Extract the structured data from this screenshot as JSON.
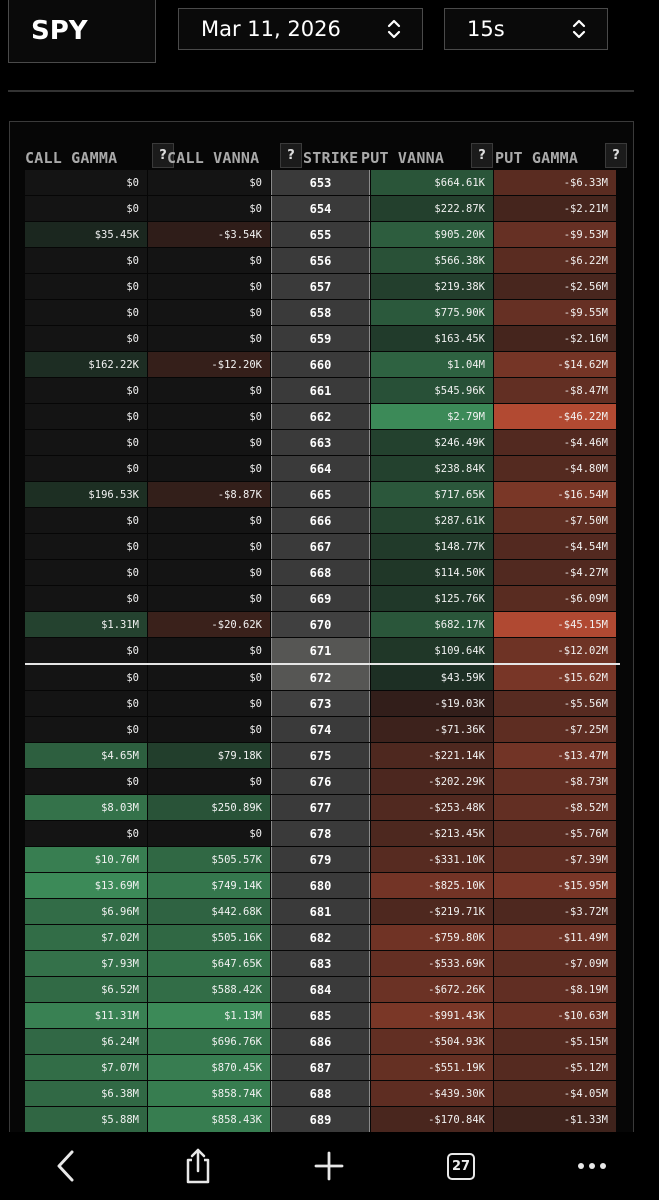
{
  "header": {
    "ticker": "SPY",
    "date": "Mar 11, 2026",
    "interval": "15s"
  },
  "table": {
    "columns": [
      {
        "label": "CALL GAMMA",
        "help": "?"
      },
      {
        "label": "CALL VANNA",
        "help": "?"
      },
      {
        "label": "STRIKE",
        "help": ""
      },
      {
        "label": "PUT VANNA",
        "help": "?"
      },
      {
        "label": "PUT GAMMA",
        "help": "?"
      }
    ],
    "current_price_after_strike": "671",
    "rows": [
      {
        "call_gamma": "$0",
        "call_vanna": "$0",
        "strike": "653",
        "put_vanna": "$664.61K",
        "put_gamma": "-$6.33M"
      },
      {
        "call_gamma": "$0",
        "call_vanna": "$0",
        "strike": "654",
        "put_vanna": "$222.87K",
        "put_gamma": "-$2.21M"
      },
      {
        "call_gamma": "$35.45K",
        "call_vanna": "-$3.54K",
        "strike": "655",
        "put_vanna": "$905.20K",
        "put_gamma": "-$9.53M"
      },
      {
        "call_gamma": "$0",
        "call_vanna": "$0",
        "strike": "656",
        "put_vanna": "$566.38K",
        "put_gamma": "-$6.22M"
      },
      {
        "call_gamma": "$0",
        "call_vanna": "$0",
        "strike": "657",
        "put_vanna": "$219.38K",
        "put_gamma": "-$2.56M"
      },
      {
        "call_gamma": "$0",
        "call_vanna": "$0",
        "strike": "658",
        "put_vanna": "$775.90K",
        "put_gamma": "-$9.55M"
      },
      {
        "call_gamma": "$0",
        "call_vanna": "$0",
        "strike": "659",
        "put_vanna": "$163.45K",
        "put_gamma": "-$2.16M"
      },
      {
        "call_gamma": "$162.22K",
        "call_vanna": "-$12.20K",
        "strike": "660",
        "put_vanna": "$1.04M",
        "put_gamma": "-$14.62M"
      },
      {
        "call_gamma": "$0",
        "call_vanna": "$0",
        "strike": "661",
        "put_vanna": "$545.96K",
        "put_gamma": "-$8.47M"
      },
      {
        "call_gamma": "$0",
        "call_vanna": "$0",
        "strike": "662",
        "put_vanna": "$2.79M",
        "put_gamma": "-$46.22M"
      },
      {
        "call_gamma": "$0",
        "call_vanna": "$0",
        "strike": "663",
        "put_vanna": "$246.49K",
        "put_gamma": "-$4.46M"
      },
      {
        "call_gamma": "$0",
        "call_vanna": "$0",
        "strike": "664",
        "put_vanna": "$238.84K",
        "put_gamma": "-$4.80M"
      },
      {
        "call_gamma": "$196.53K",
        "call_vanna": "-$8.87K",
        "strike": "665",
        "put_vanna": "$717.65K",
        "put_gamma": "-$16.54M"
      },
      {
        "call_gamma": "$0",
        "call_vanna": "$0",
        "strike": "666",
        "put_vanna": "$287.61K",
        "put_gamma": "-$7.50M"
      },
      {
        "call_gamma": "$0",
        "call_vanna": "$0",
        "strike": "667",
        "put_vanna": "$148.77K",
        "put_gamma": "-$4.54M"
      },
      {
        "call_gamma": "$0",
        "call_vanna": "$0",
        "strike": "668",
        "put_vanna": "$114.50K",
        "put_gamma": "-$4.27M"
      },
      {
        "call_gamma": "$0",
        "call_vanna": "$0",
        "strike": "669",
        "put_vanna": "$125.76K",
        "put_gamma": "-$6.09M"
      },
      {
        "call_gamma": "$1.31M",
        "call_vanna": "-$20.62K",
        "strike": "670",
        "put_vanna": "$682.17K",
        "put_gamma": "-$45.15M"
      },
      {
        "call_gamma": "$0",
        "call_vanna": "$0",
        "strike": "671",
        "put_vanna": "$109.64K",
        "put_gamma": "-$12.02M"
      },
      {
        "call_gamma": "$0",
        "call_vanna": "$0",
        "strike": "672",
        "put_vanna": "$43.59K",
        "put_gamma": "-$15.62M"
      },
      {
        "call_gamma": "$0",
        "call_vanna": "$0",
        "strike": "673",
        "put_vanna": "-$19.03K",
        "put_gamma": "-$5.56M"
      },
      {
        "call_gamma": "$0",
        "call_vanna": "$0",
        "strike": "674",
        "put_vanna": "-$71.36K",
        "put_gamma": "-$7.25M"
      },
      {
        "call_gamma": "$4.65M",
        "call_vanna": "$79.18K",
        "strike": "675",
        "put_vanna": "-$221.14K",
        "put_gamma": "-$13.47M"
      },
      {
        "call_gamma": "$0",
        "call_vanna": "$0",
        "strike": "676",
        "put_vanna": "-$202.29K",
        "put_gamma": "-$8.73M"
      },
      {
        "call_gamma": "$8.03M",
        "call_vanna": "$250.89K",
        "strike": "677",
        "put_vanna": "-$253.48K",
        "put_gamma": "-$8.52M"
      },
      {
        "call_gamma": "$0",
        "call_vanna": "$0",
        "strike": "678",
        "put_vanna": "-$213.45K",
        "put_gamma": "-$5.76M"
      },
      {
        "call_gamma": "$10.76M",
        "call_vanna": "$505.57K",
        "strike": "679",
        "put_vanna": "-$331.10K",
        "put_gamma": "-$7.39M"
      },
      {
        "call_gamma": "$13.69M",
        "call_vanna": "$749.14K",
        "strike": "680",
        "put_vanna": "-$825.10K",
        "put_gamma": "-$15.95M"
      },
      {
        "call_gamma": "$6.96M",
        "call_vanna": "$442.68K",
        "strike": "681",
        "put_vanna": "-$219.71K",
        "put_gamma": "-$3.72M"
      },
      {
        "call_gamma": "$7.02M",
        "call_vanna": "$505.16K",
        "strike": "682",
        "put_vanna": "-$759.80K",
        "put_gamma": "-$11.49M"
      },
      {
        "call_gamma": "$7.93M",
        "call_vanna": "$647.65K",
        "strike": "683",
        "put_vanna": "-$533.69K",
        "put_gamma": "-$7.09M"
      },
      {
        "call_gamma": "$6.52M",
        "call_vanna": "$588.42K",
        "strike": "684",
        "put_vanna": "-$672.26K",
        "put_gamma": "-$8.19M"
      },
      {
        "call_gamma": "$11.31M",
        "call_vanna": "$1.13M",
        "strike": "685",
        "put_vanna": "-$991.43K",
        "put_gamma": "-$10.63M"
      },
      {
        "call_gamma": "$6.24M",
        "call_vanna": "$696.76K",
        "strike": "686",
        "put_vanna": "-$504.93K",
        "put_gamma": "-$5.15M"
      },
      {
        "call_gamma": "$7.07M",
        "call_vanna": "$870.45K",
        "strike": "687",
        "put_vanna": "-$551.19K",
        "put_gamma": "-$5.12M"
      },
      {
        "call_gamma": "$6.38M",
        "call_vanna": "$858.74K",
        "strike": "688",
        "put_vanna": "-$439.30K",
        "put_gamma": "-$4.05M"
      },
      {
        "call_gamma": "$5.88M",
        "call_vanna": "$858.43K",
        "strike": "689",
        "put_vanna": "-$170.84K",
        "put_gamma": "-$1.33M"
      }
    ]
  },
  "colors": {
    "positive": "#3c8a58",
    "negative": "#b24a32",
    "neutral": "#141414",
    "strike": "#3a3a3a",
    "strike_near_price": "#5a5a58"
  },
  "browser_toolbar": {
    "back": "back-icon",
    "share": "share-icon",
    "new_tab": "plus-icon",
    "tab_count": "27",
    "more": "more-icon"
  }
}
